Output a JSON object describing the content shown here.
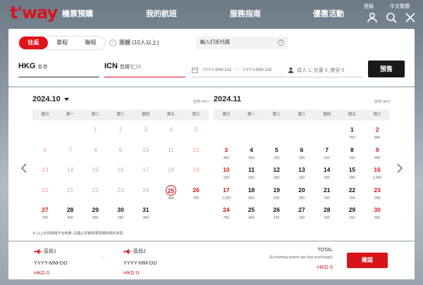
{
  "header": {
    "logo": "t'way",
    "nav": [
      "機票預購",
      "我的航班",
      "服務指南",
      "優惠活動"
    ],
    "util": [
      "登錄",
      "中文繁體"
    ]
  },
  "search": {
    "trip_types": [
      "往返",
      "單程",
      "聯程"
    ],
    "active_trip": 0,
    "group_label": "團體 (10人以上)",
    "promo_placeholder": "輸入打折代碼",
    "promo_help": "?",
    "dep_code": "HKG",
    "dep_city": "香港",
    "arr_code": "ICN",
    "arr_city": "首爾/仁川",
    "date_from": "YYYY-MM-DD",
    "date_sep": "~",
    "date_to": "YYYY-MM-DD",
    "pax": "成人 1, 兒童 0, 嬰兒 0",
    "book_label": "預售"
  },
  "calendar": {
    "currency_note": "貨幣:HKD",
    "weekdays": [
      "周日",
      "周一",
      "周二",
      "周三",
      "周四",
      "周五",
      "周六"
    ],
    "months": [
      {
        "title": "2024.10",
        "offset": 2,
        "days": [
          {
            "n": "1"
          },
          {
            "n": "2"
          },
          {
            "n": "3"
          },
          {
            "n": "4"
          },
          {
            "n": "5"
          },
          {
            "n": "6"
          },
          {
            "n": "7"
          },
          {
            "n": "8"
          },
          {
            "n": "9"
          },
          {
            "n": "10"
          },
          {
            "n": "11"
          },
          {
            "n": "12"
          },
          {
            "n": "13"
          },
          {
            "n": "14"
          },
          {
            "n": "15"
          },
          {
            "n": "16"
          },
          {
            "n": "17"
          },
          {
            "n": "18"
          },
          {
            "n": "19"
          },
          {
            "n": "20"
          },
          {
            "n": "21"
          },
          {
            "n": "22"
          },
          {
            "n": "23"
          },
          {
            "n": "24"
          },
          {
            "n": "25",
            "p": "450",
            "today": true
          },
          {
            "n": "26",
            "p": "750"
          },
          {
            "n": "27",
            "p": "750"
          },
          {
            "n": "28",
            "p": "450"
          },
          {
            "n": "29",
            "p": "550"
          },
          {
            "n": "30",
            "p": "250"
          },
          {
            "n": "31",
            "p": "390"
          }
        ]
      },
      {
        "title": "2024.11",
        "offset": 5,
        "days": [
          {
            "n": "1",
            "p": "750"
          },
          {
            "n": "2",
            "p": "890"
          },
          {
            "n": "3",
            "p": "450"
          },
          {
            "n": "4",
            "p": "450"
          },
          {
            "n": "5",
            "p": "150"
          },
          {
            "n": "6",
            "p": "150"
          },
          {
            "n": "7",
            "p": "150"
          },
          {
            "n": "8",
            "p": "150"
          },
          {
            "n": "9",
            "p": "450"
          },
          {
            "n": "10",
            "p": "150"
          },
          {
            "n": "11",
            "p": "550"
          },
          {
            "n": "12",
            "p": "390"
          },
          {
            "n": "13",
            "p": "150"
          },
          {
            "n": "14",
            "p": "150"
          },
          {
            "n": "15",
            "p": "390"
          },
          {
            "n": "16",
            "p": "1,450"
          },
          {
            "n": "17",
            "p": "1,250"
          },
          {
            "n": "18",
            "p": "890"
          },
          {
            "n": "19",
            "p": "250"
          },
          {
            "n": "20",
            "p": "250"
          },
          {
            "n": "21",
            "p": "150"
          },
          {
            "n": "22",
            "p": "150"
          },
          {
            "n": "23",
            "p": "250"
          },
          {
            "n": "24",
            "p": "750"
          },
          {
            "n": "25",
            "p": "450"
          },
          {
            "n": "26",
            "p": "150"
          },
          {
            "n": "27",
            "p": "150"
          },
          {
            "n": "28",
            "p": "150"
          },
          {
            "n": "29",
            "p": "150"
          },
          {
            "n": "30",
            "p": "550"
          }
        ]
      }
    ],
    "note": "※ 以上內容價格不含稅費, 具體以您實際選擇購物車的為準。"
  },
  "footer": {
    "seg1_label": "區段1",
    "seg1_date": "YYYY-MM-DD",
    "seg1_price": "HKD 0",
    "seg2_label": "區段2",
    "seg2_date": "YYYY-MM-DD",
    "seg2_price": "HKD 0",
    "arrow": "→",
    "total_label": "TOTAL",
    "total_sub": "(Excluding airport tax fuel surcharge)",
    "total_price": "HKD 0",
    "confirm_label": "確認"
  },
  "colors": {
    "brand": "#d7141a",
    "dark": "#1a1a1a"
  }
}
